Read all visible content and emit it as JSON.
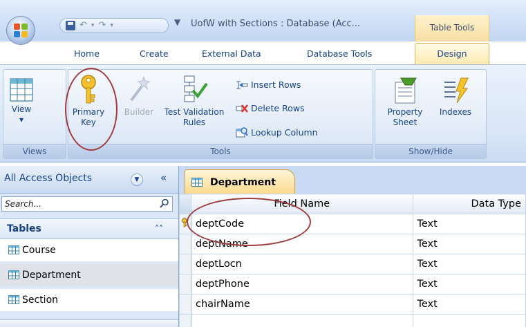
{
  "title_bar": {
    "window_title": "UofW with Sections : Database (Acc...",
    "contextual_tab_group": "Table Tools",
    "qat_dropdown_glyph": "≡"
  },
  "tabs": [
    {
      "label": "Home"
    },
    {
      "label": "Create"
    },
    {
      "label": "External Data"
    },
    {
      "label": "Database Tools"
    },
    {
      "label": "Design",
      "active": true
    }
  ],
  "ribbon": {
    "views_group": {
      "label": "Views",
      "view_button": "View",
      "view_arrow": "▾"
    },
    "tools_group": {
      "label": "Tools",
      "primary_key_line1": "Primary",
      "primary_key_line2": "Key",
      "builder": "Builder",
      "test_validation_line1": "Test Validation",
      "test_validation_line2": "Rules",
      "insert_rows": "Insert Rows",
      "delete_rows": "Delete Rows",
      "lookup_column": "Lookup Column"
    },
    "show_hide_group": {
      "label": "Show/Hide",
      "property_sheet_line1": "Property",
      "property_sheet_line2": "Sheet",
      "indexes": "Indexes"
    }
  },
  "nav_pane": {
    "header": "All Access Objects",
    "collapse_glyph": "«",
    "search_placeholder": "Search...",
    "tables_header": "Tables",
    "tables_chevron": "˄˄",
    "items": [
      {
        "label": "Course"
      },
      {
        "label": "Department",
        "selected": true
      },
      {
        "label": "Section"
      }
    ]
  },
  "document": {
    "tab_label": "Department",
    "columns": [
      "Field Name",
      "Data Type"
    ],
    "rows": [
      {
        "field": "deptCode",
        "type": "Text",
        "primary_key": true
      },
      {
        "field": "deptName",
        "type": "Text"
      },
      {
        "field": "deptLocn",
        "type": "Text"
      },
      {
        "field": "deptPhone",
        "type": "Text"
      },
      {
        "field": "chairName",
        "type": "Text"
      }
    ]
  },
  "colors": {
    "ribbon_text": "#15428b",
    "contextual_tab": "#fdeab0",
    "annotation": "#a03c3c"
  }
}
